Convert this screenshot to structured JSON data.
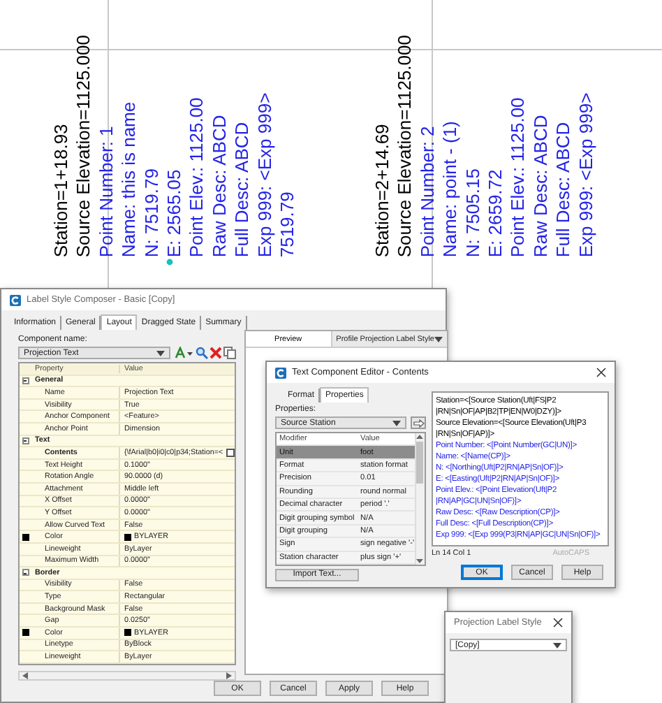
{
  "labels": [
    {
      "lines": [
        {
          "text": "Station=1+18.93",
          "color": "#000000"
        },
        {
          "text": "Source Elevation=1125.000",
          "color": "#000000"
        },
        {
          "text": "Point Number: 1",
          "color": "#2323e6"
        },
        {
          "text": "Name: this is name",
          "color": "#2323e6"
        },
        {
          "text": "N: 7519.79",
          "color": "#2323e6"
        },
        {
          "text": "E: 2565.05",
          "color": "#2323e6"
        },
        {
          "text": "Point Elev.: 1125.00",
          "color": "#2323e6"
        },
        {
          "text": "Raw Desc: ABCD",
          "color": "#2323e6"
        },
        {
          "text": "Full Desc: ABCD",
          "color": "#2323e6"
        },
        {
          "text": "Exp 999: <Exp 999>",
          "color": "#2323e6"
        },
        {
          "text": "7519.79",
          "color": "#2323e6"
        }
      ]
    },
    {
      "lines": [
        {
          "text": "Station=2+14.69",
          "color": "#000000"
        },
        {
          "text": "Source Elevation=1125.000",
          "color": "#000000"
        },
        {
          "text": "Point Number: 2",
          "color": "#2323e6"
        },
        {
          "text": "Name: point - (1)",
          "color": "#2323e6"
        },
        {
          "text": "N: 7505.15",
          "color": "#2323e6"
        },
        {
          "text": "E: 2659.72",
          "color": "#2323e6"
        },
        {
          "text": "Point Elev.: 1125.00",
          "color": "#2323e6"
        },
        {
          "text": "Raw Desc: ABCD",
          "color": "#2323e6"
        },
        {
          "text": "Full Desc: ABCD",
          "color": "#2323e6"
        },
        {
          "text": "Exp 999: <Exp 999>",
          "color": "#2323e6"
        }
      ]
    }
  ],
  "composer": {
    "title": "Label Style Composer - Basic [Copy]",
    "tabs": [
      {
        "label": "Information",
        "selected": false
      },
      {
        "label": "General",
        "selected": false
      },
      {
        "label": "Layout",
        "selected": true
      },
      {
        "label": "Dragged State",
        "selected": false
      },
      {
        "label": "Summary",
        "selected": false
      }
    ],
    "component_label": "Component name:",
    "component": "Projection Text",
    "grid": {
      "columns": [
        "Property",
        "Value"
      ],
      "rows": [
        {
          "kind": "section",
          "label": "General",
          "expanded": true
        },
        {
          "kind": "prop",
          "property": "Name",
          "value": "Projection Text",
          "selected": false
        },
        {
          "kind": "prop",
          "property": "Visibility",
          "value": "True",
          "selected": false
        },
        {
          "kind": "prop",
          "property": "Anchor Component",
          "value": "<Feature>",
          "selected": false
        },
        {
          "kind": "prop",
          "property": "Anchor Point",
          "value": "Dimension",
          "selected": false
        },
        {
          "kind": "section",
          "label": "Text",
          "expanded": true
        },
        {
          "kind": "prop",
          "property": "Contents",
          "value": "{\\fArial|b0|i0|c0|p34;Station=<",
          "selected": true
        },
        {
          "kind": "prop",
          "property": "Text Height",
          "value": "0.1000\"",
          "selected": false
        },
        {
          "kind": "prop",
          "property": "Rotation Angle",
          "value": "90.0000 (d)",
          "selected": false
        },
        {
          "kind": "prop",
          "property": "Attachment",
          "value": "Middle left",
          "selected": false
        },
        {
          "kind": "prop",
          "property": "X Offset",
          "value": "0.0000\"",
          "selected": false
        },
        {
          "kind": "prop",
          "property": "Y Offset",
          "value": "0.0000\"",
          "selected": false
        },
        {
          "kind": "prop",
          "property": "Allow Curved Text",
          "value": "False",
          "selected": false
        },
        {
          "kind": "color",
          "property": "Color",
          "value": "BYLAYER",
          "color": "#000000",
          "selected": false
        },
        {
          "kind": "prop",
          "property": "Lineweight",
          "value": "ByLayer",
          "selected": false
        },
        {
          "kind": "prop",
          "property": "Maximum Width",
          "value": "0.0000\"",
          "selected": false
        },
        {
          "kind": "section",
          "label": "Border",
          "expanded": true
        },
        {
          "kind": "prop",
          "property": "Visibility",
          "value": "False",
          "selected": false
        },
        {
          "kind": "prop",
          "property": "Type",
          "value": "Rectangular",
          "selected": false
        },
        {
          "kind": "prop",
          "property": "Background Mask",
          "value": "False",
          "selected": false
        },
        {
          "kind": "prop",
          "property": "Gap",
          "value": "0.0250\"",
          "selected": false
        },
        {
          "kind": "color",
          "property": "Color",
          "value": "BYLAYER",
          "color": "#000000",
          "selected": false
        },
        {
          "kind": "prop",
          "property": "Linetype",
          "value": "ByBlock",
          "selected": false
        },
        {
          "kind": "prop",
          "property": "Lineweight",
          "value": "ByLayer",
          "selected": false
        }
      ]
    },
    "preview_tab": "Preview",
    "preview_style": "Profile Projection Label Style",
    "buttons": [
      {
        "label": "OK",
        "default": false
      },
      {
        "label": "Cancel",
        "default": false
      },
      {
        "label": "Apply",
        "default": false
      },
      {
        "label": "Help",
        "default": false
      }
    ]
  },
  "editor": {
    "title": "Text Component Editor - Contents",
    "tabs": [
      {
        "label": "Format",
        "selected": false
      },
      {
        "label": "Properties",
        "selected": true
      }
    ],
    "properties_label": "Properties:",
    "property": "Source Station",
    "table": {
      "columns": [
        "Modifier",
        "Value"
      ],
      "rows": [
        {
          "modifier": "Unit",
          "value": "foot",
          "selected": true
        },
        {
          "modifier": "Format",
          "value": "station format",
          "selected": false
        },
        {
          "modifier": "Precision",
          "value": "0.01",
          "selected": false
        },
        {
          "modifier": "Rounding",
          "value": "round normal",
          "selected": false
        },
        {
          "modifier": "Decimal character",
          "value": "period '.'",
          "selected": false
        },
        {
          "modifier": "Digit grouping symbol",
          "value": "N/A",
          "selected": false
        },
        {
          "modifier": "Digit grouping",
          "value": "N/A",
          "selected": false
        },
        {
          "modifier": "Sign",
          "value": "sign negative '-'",
          "selected": false
        },
        {
          "modifier": "Station character",
          "value": "plus sign '+'",
          "selected": false
        }
      ]
    },
    "import_button": "Import Text...",
    "content_lines": [
      {
        "text": "Station=<[Source Station(Uft|FS|P2",
        "color": "#000000"
      },
      {
        "text": "|RN|Sn|OF|AP|B2|TP|EN|W0|DZY)]>",
        "color": "#000000"
      },
      {
        "text": "Source Elevation=<[Source Elevation(Uft|P3",
        "color": "#000000"
      },
      {
        "text": "|RN|Sn|OF|AP)]>",
        "color": "#000000"
      },
      {
        "text": "Point Number: <[Point Number(GC|UN)]>",
        "color": "#2323e6"
      },
      {
        "text": "Name: <[Name(CP)]>",
        "color": "#2323e6"
      },
      {
        "text": "N: <[Northing(Uft|P2|RN|AP|Sn|OF)]>",
        "color": "#2323e6"
      },
      {
        "text": "E: <[Easting(Uft|P2|RN|AP|Sn|OF)]>",
        "color": "#2323e6"
      },
      {
        "text": "Point Elev.: <[Point Elevation(Uft|P2",
        "color": "#2323e6"
      },
      {
        "text": "|RN|AP|GC|UN|Sn|OF)]>",
        "color": "#2323e6"
      },
      {
        "text": "Raw Desc: <[Raw Description(CP)]>",
        "color": "#2323e6"
      },
      {
        "text": "Full Desc: <[Full Description(CP)]>",
        "color": "#2323e6"
      },
      {
        "text": "Exp 999: <[Exp 999(P3|RN|AP|GC|UN|Sn|OF)]>",
        "color": "#2323e6"
      }
    ],
    "status": "Ln 14 Col 1",
    "autocaps": {
      "label": "AutoCAPS",
      "disabled": true
    },
    "buttons": [
      {
        "label": "OK",
        "default": true
      },
      {
        "label": "Cancel",
        "default": false
      },
      {
        "label": "Help",
        "default": false
      }
    ]
  },
  "small_dialog": {
    "title": "Projection Label Style",
    "select": "[Copy]"
  }
}
